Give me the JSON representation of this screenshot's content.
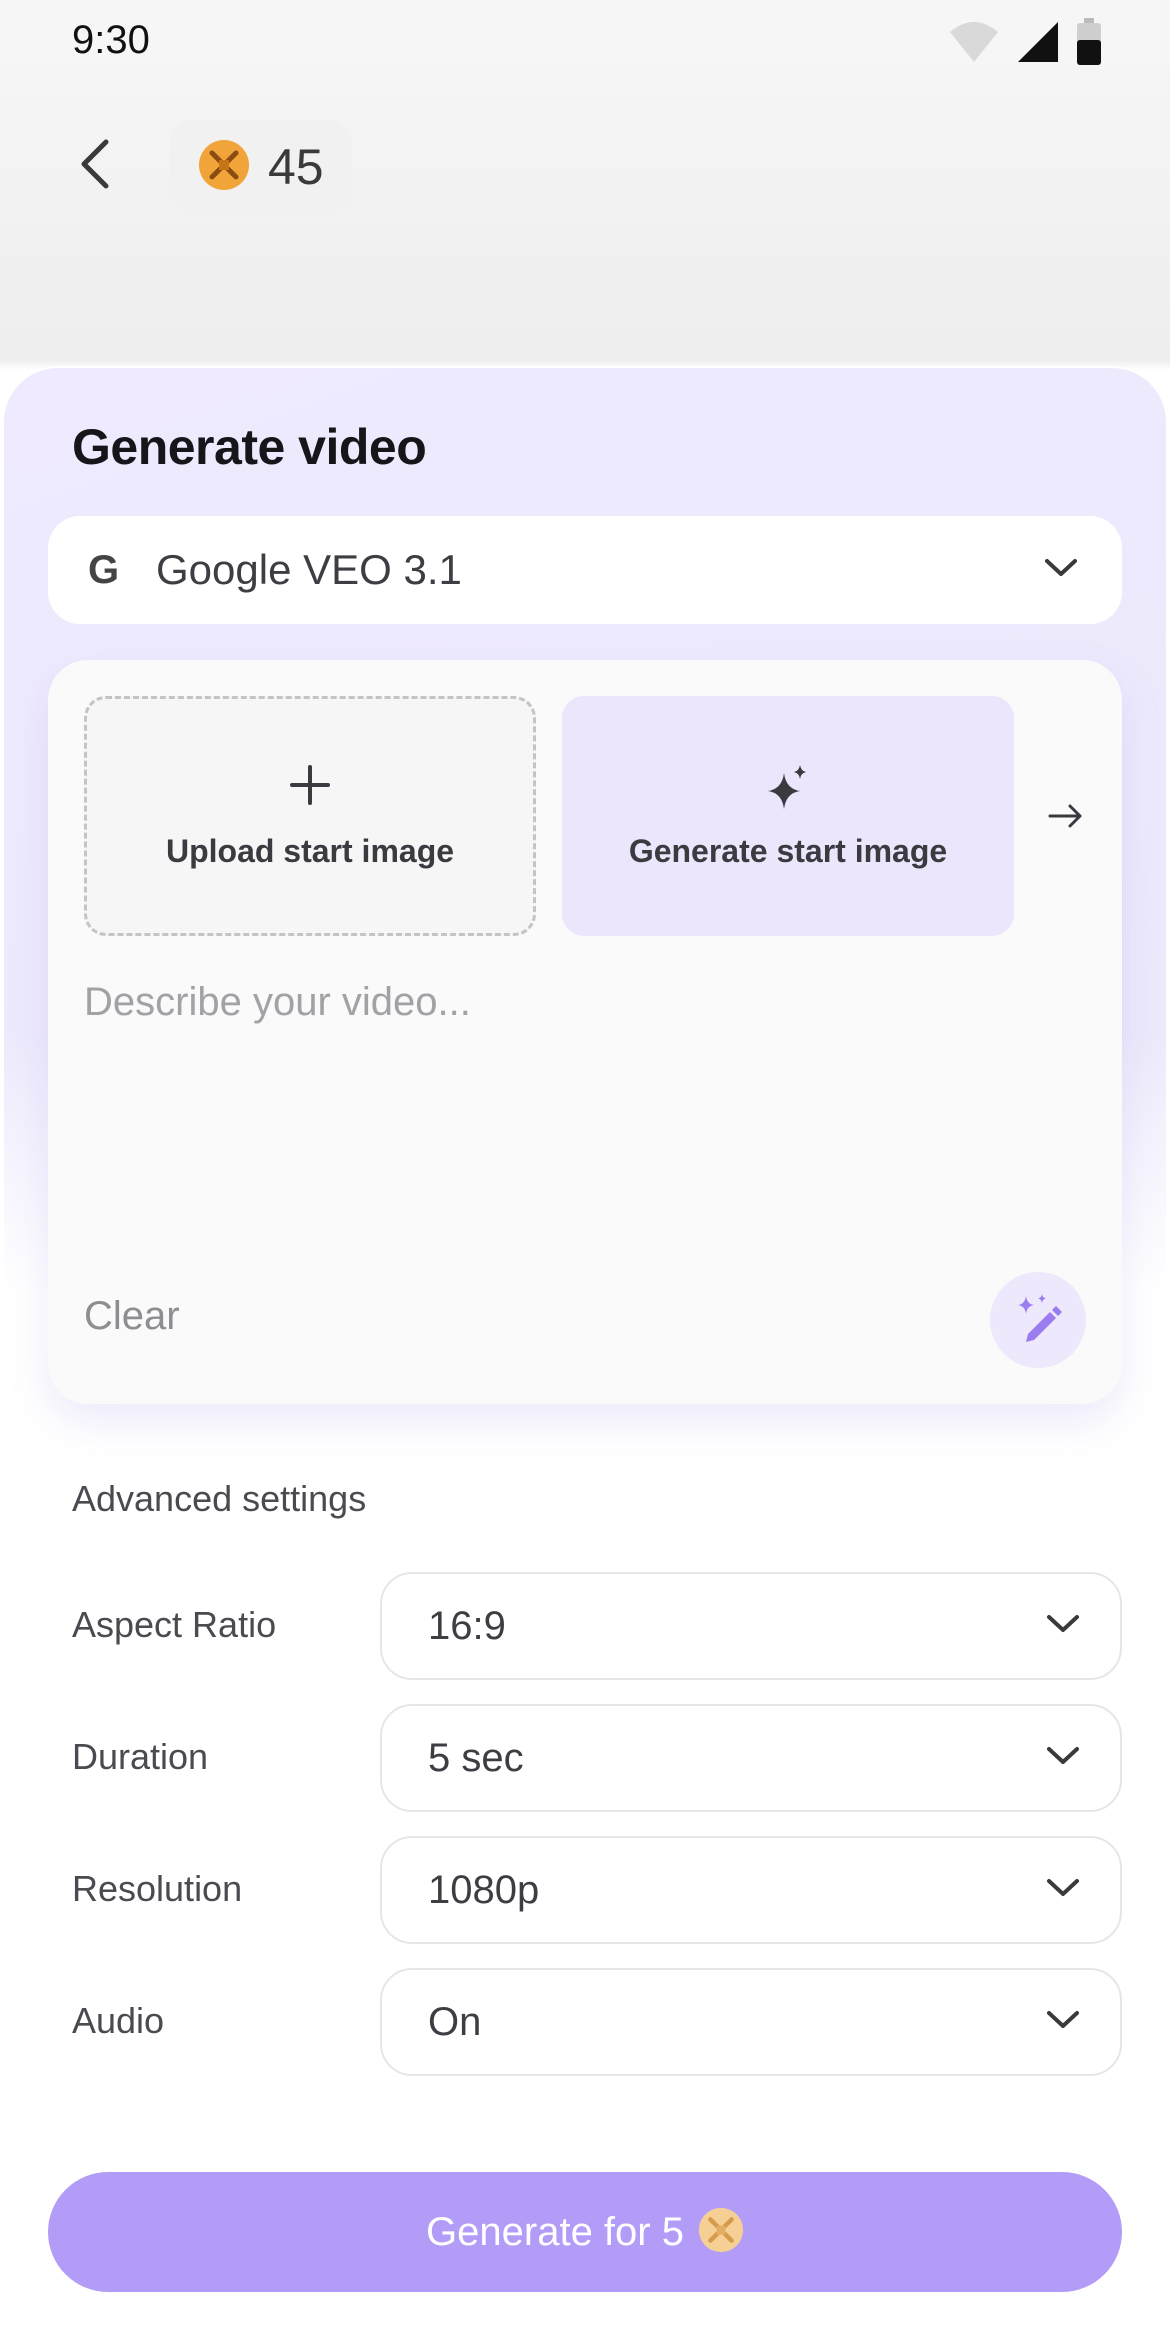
{
  "status_bar": {
    "time": "9:30"
  },
  "header": {
    "credits": "45"
  },
  "main": {
    "title": "Generate video",
    "model": {
      "logo": "G",
      "name": "Google VEO 3.1"
    },
    "upload_tile_label": "Upload start image",
    "generate_tile_label": "Generate start image",
    "prompt_placeholder": "Describe your video...",
    "clear_label": "Clear"
  },
  "advanced": {
    "title": "Advanced settings",
    "settings": [
      {
        "label": "Aspect Ratio",
        "value": "16:9"
      },
      {
        "label": "Duration",
        "value": "5 sec"
      },
      {
        "label": "Resolution",
        "value": "1080p"
      },
      {
        "label": "Audio",
        "value": "On"
      }
    ]
  },
  "footer": {
    "generate_label": "Generate for 5"
  },
  "colors": {
    "accent": "#b39cf8",
    "coin": "#f0a43a",
    "tile_purple": "#ebe6fb"
  },
  "icons": [
    "wifi-icon",
    "signal-icon",
    "battery-icon",
    "back-icon",
    "coin-icon",
    "chevron-down-icon",
    "plus-icon",
    "sparkle-icon",
    "arrow-right-icon",
    "magic-pen-icon"
  ]
}
